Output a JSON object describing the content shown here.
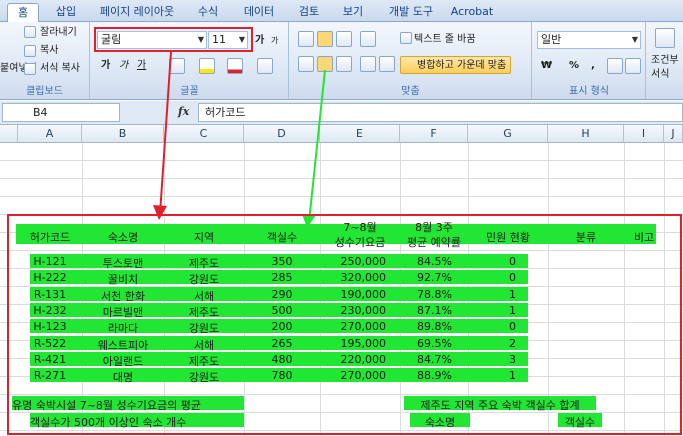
{
  "tabs": [
    "홈",
    "삽입",
    "페이지 레이아웃",
    "수식",
    "데이터",
    "검토",
    "보기",
    "개발 도구",
    "Acrobat"
  ],
  "ribbon": {
    "clipboard": {
      "paste": "붙여넣기",
      "cut": "잘라내기",
      "copy": "복사",
      "format_painter": "서식 복사",
      "label": "클립보드"
    },
    "font": {
      "name": "굴림",
      "size": "11",
      "bold": "가",
      "italic": "가",
      "underline": "가",
      "label": "글꼴",
      "grow": "가",
      "shrink": "가"
    },
    "align": {
      "wrap": "텍스트 줄 바꿈",
      "merge": "병합하고 가운데 맞춤",
      "label": "맞춤"
    },
    "number": {
      "format": "일반",
      "currency": "₩",
      "percent": "%",
      "comma": ",",
      "inc": "←.0 .00",
      "dec": ".00 →.0",
      "label": "표시 형식"
    },
    "styles": {
      "cond": "조건부",
      "fmt": "서식"
    }
  },
  "formula_bar": {
    "cell_ref": "B4",
    "fx": "fx",
    "content": "허가코드"
  },
  "columns": [
    "A",
    "B",
    "C",
    "D",
    "E",
    "F",
    "G",
    "H",
    "I",
    "J"
  ],
  "table": {
    "headers": [
      "허가코드",
      "숙소명",
      "지역",
      "객실수",
      "7~8월\n성수기요금",
      "8월 3주\n평균 예약률",
      "민원 현황",
      "분류",
      "비고"
    ],
    "rows": [
      [
        "H-121",
        "투스토맨",
        "제주도",
        "350",
        "250,000",
        "84.5%",
        "0"
      ],
      [
        "H-222",
        "꿀비치",
        "강원도",
        "285",
        "320,000",
        "92.7%",
        "0"
      ],
      [
        "R-131",
        "서천 한화",
        "서해",
        "290",
        "190,000",
        "78.8%",
        "1"
      ],
      [
        "H-232",
        "마르빌맨",
        "제주도",
        "500",
        "230,000",
        "87.1%",
        "1"
      ],
      [
        "H-123",
        "라마다",
        "강원도",
        "200",
        "270,000",
        "89.8%",
        "0"
      ],
      [
        "R-522",
        "웨스트피아",
        "서해",
        "265",
        "195,000",
        "69.5%",
        "2"
      ],
      [
        "R-421",
        "아일랜드",
        "제주도",
        "480",
        "220,000",
        "84.7%",
        "3"
      ],
      [
        "R-271",
        "대명",
        "강원도",
        "780",
        "270,000",
        "88.9%",
        "1"
      ]
    ],
    "footer": {
      "avg_label": "유명 숙박시설 7~8월 성수기요금의 평균",
      "count_label": "객실수가 500개 이상인 숙소 개수",
      "jeju_label": "제주도 지역 주요 숙박 객실수 합계",
      "lodge_label": "숙소명",
      "rooms_label": "객실수"
    }
  },
  "colors": {
    "highlight": "#22e634",
    "frame": "#e0202a",
    "arrow_green": "#22e634"
  }
}
